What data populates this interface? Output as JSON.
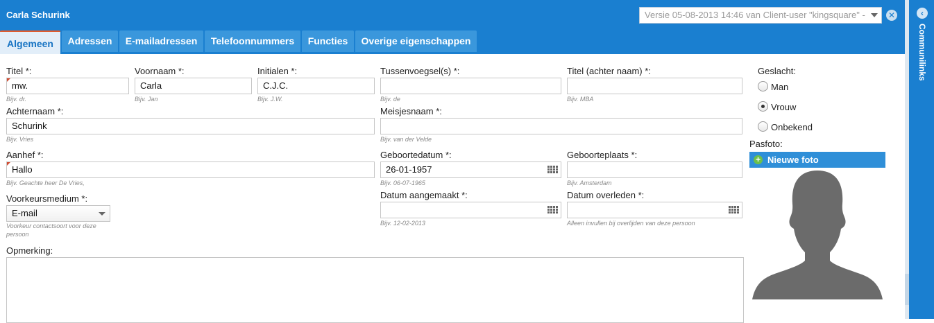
{
  "window": {
    "title": "Carla Schurink",
    "version": "Versie 05-08-2013 14:46 van Client-user \"kingsquare\" -"
  },
  "tabs": [
    "Algemeen",
    "Adressen",
    "E-mailadressen",
    "Telefoonnummers",
    "Functies",
    "Overige eigenschappen"
  ],
  "sidepanel": {
    "label": "Communilinks"
  },
  "fields": {
    "titel": {
      "label": "Titel *:",
      "value": "mw.",
      "hint": "Bijv. dr."
    },
    "voornaam": {
      "label": "Voornaam *:",
      "value": "Carla",
      "hint": "Bijv. Jan"
    },
    "initialen": {
      "label": "Initialen *:",
      "value": "C.J.C.",
      "hint": "Bijv. J.W."
    },
    "tussenvoegsel": {
      "label": "Tussenvoegsel(s) *:",
      "value": "",
      "hint": "Bijv. de"
    },
    "titel_achter": {
      "label": "Titel (achter naam) *:",
      "value": "",
      "hint": "Bijv. MBA"
    },
    "achternaam": {
      "label": "Achternaam *:",
      "value": "Schurink",
      "hint": "Bijv. Vries"
    },
    "meisjesnaam": {
      "label": "Meisjesnaam *:",
      "value": "",
      "hint": "Bijv. van der Velde"
    },
    "aanhef": {
      "label": "Aanhef *:",
      "value": "Hallo",
      "hint": "Bijv. Geachte heer De Vries,"
    },
    "geboortedatum": {
      "label": "Geboortedatum *:",
      "value": "26-01-1957",
      "hint": "Bijv. 06-07-1965"
    },
    "geboorteplaats": {
      "label": "Geboorteplaats *:",
      "value": "",
      "hint": "Bijv. Amsterdam"
    },
    "voorkeursmedium": {
      "label": "Voorkeursmedium *:",
      "value": "E-mail",
      "hint1": "Voorkeur contactsoort voor deze",
      "hint2": "persoon"
    },
    "datum_aangemaakt": {
      "label": "Datum aangemaakt *:",
      "value": "",
      "hint": "Bijv. 12-02-2013"
    },
    "datum_overleden": {
      "label": "Datum overleden *:",
      "value": "",
      "hint": "Alleen invullen bij overlijden van deze persoon"
    },
    "opmerking": {
      "label": "Opmerking:"
    }
  },
  "geslacht": {
    "label": "Geslacht:",
    "options": [
      "Man",
      "Vrouw",
      "Onbekend"
    ],
    "selected": "Vrouw"
  },
  "pasfoto": {
    "label": "Pasfoto:",
    "button": "Nieuwe foto"
  }
}
